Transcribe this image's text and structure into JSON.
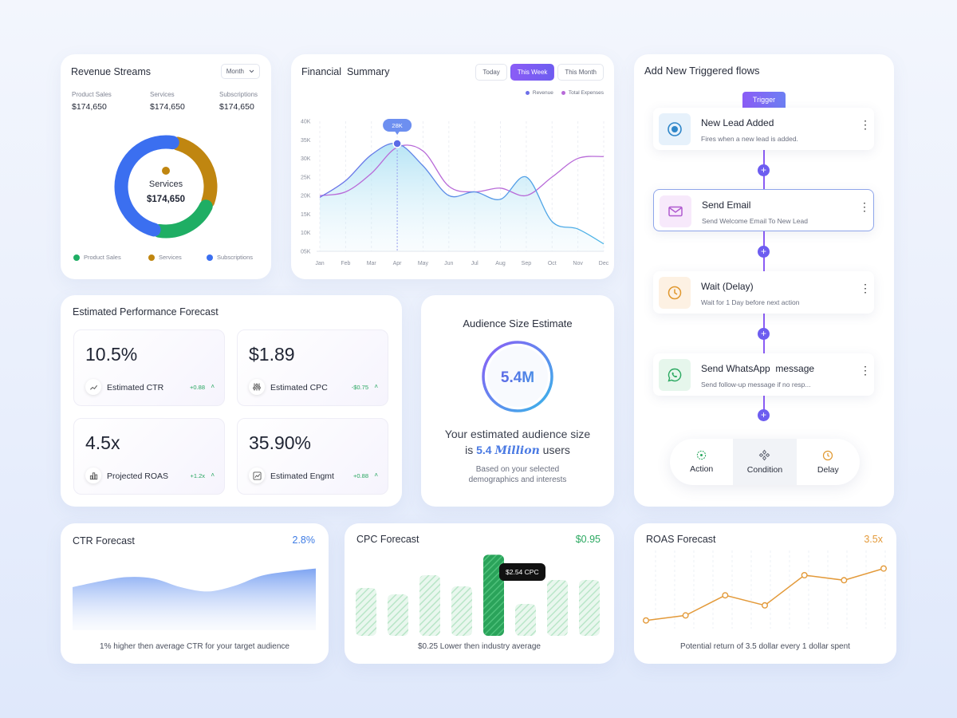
{
  "revenue": {
    "title": "Revenue Streams",
    "dropdown": "Month",
    "stats": [
      {
        "label": "Product Sales",
        "value": "$174,650"
      },
      {
        "label": "Services",
        "value": "$174,650"
      },
      {
        "label": "Subscriptions",
        "value": "$174,650"
      }
    ],
    "center_label": "Services",
    "center_value": "$174,650",
    "legend": [
      {
        "label": "Product Sales",
        "color": "#1fae64"
      },
      {
        "label": "Services",
        "color": "#c08610"
      },
      {
        "label": "Subscriptions",
        "color": "#3b6ff0"
      }
    ]
  },
  "financial": {
    "title": "Financial  Summary",
    "tabs": [
      "Today",
      "This Week",
      "This Month"
    ],
    "active_tab": "This Week",
    "legend": [
      {
        "label": "Revenue",
        "color": "#6d6fe8"
      },
      {
        "label": "Total Expenses",
        "color": "#b86ad8"
      }
    ],
    "tooltip": "28K"
  },
  "flows": {
    "title": "Add New Triggered flows",
    "trigger_label": "Trigger",
    "items": [
      {
        "name": "New Lead Added",
        "desc": "Fires when a new lead is added.",
        "icon": "target-icon",
        "bg": "#e6f1fb",
        "color": "#2f86c9"
      },
      {
        "name": "Send Email",
        "desc": "Send Welcome Email To New Lead",
        "icon": "mail-icon",
        "bg": "#f7e9fb",
        "color": "#b05ad0"
      },
      {
        "name": "Wait (Delay)",
        "desc": "Wait for 1 Day before next action",
        "icon": "clock-icon",
        "bg": "#fdf1e3",
        "color": "#e0972d"
      },
      {
        "name": "Send WhatsApp  message",
        "desc": "Send follow-up message if no resp...",
        "icon": "whatsapp-icon",
        "bg": "#e6f6ec",
        "color": "#2aa860"
      }
    ],
    "tabs": [
      {
        "label": "Action",
        "icon": "action-icon",
        "color": "#2aa860"
      },
      {
        "label": "Condition",
        "icon": "condition-icon",
        "color": "#555a68"
      },
      {
        "label": "Delay",
        "icon": "clock-icon",
        "color": "#e0972d"
      }
    ],
    "active_tab": "Condition"
  },
  "performance": {
    "title": "Estimated Performance Forecast",
    "metrics": [
      {
        "value": "10.5%",
        "label": "Estimated CTR",
        "delta": "+0.88",
        "icon": "trend-icon"
      },
      {
        "value": "$1.89",
        "label": "Estimated CPC",
        "delta": "-$0.75",
        "icon": "sliders-icon"
      },
      {
        "value": "4.5x",
        "label": "Projected ROAS",
        "delta": "+1.2x",
        "icon": "bars-icon"
      },
      {
        "value": "35.90%",
        "label": "Estimated Engmt",
        "delta": "+0.88",
        "icon": "chart-icon"
      }
    ]
  },
  "audience": {
    "title": "Audience Size Estimate",
    "value": "5.4M",
    "line1": "Your estimated audience size",
    "line2_pre": "is",
    "line2_num": "5.4",
    "line2_word": "Million",
    "line2_post": "users",
    "sub1": "Based on your selected",
    "sub2": "demographics and interests"
  },
  "ctr": {
    "title": "CTR Forecast",
    "value": "2.8%",
    "note": "1% higher then average CTR for your target audience",
    "color": "#3d7be4"
  },
  "cpc": {
    "title": "CPC Forecast",
    "value": "$0.95",
    "note": "$0.25 Lower then industry average",
    "tooltip": "$2.54 CPC",
    "color": "#2aa860"
  },
  "roas": {
    "title": "ROAS Forecast",
    "value": "3.5x",
    "note": "Potential return of 3.5 dollar every 1 dollar spent",
    "color": "#e39a3a"
  },
  "chart_data": [
    {
      "type": "pie",
      "title": "Revenue Streams",
      "categories": [
        "Product Sales",
        "Services",
        "Subscriptions"
      ],
      "values": [
        22,
        28,
        50
      ]
    },
    {
      "type": "line",
      "title": "Financial  Summary",
      "categories": [
        "Jan",
        "Feb",
        "Mar",
        "Apr",
        "May",
        "Jun",
        "Jul",
        "Aug",
        "Sep",
        "Oct",
        "Nov",
        "Dec"
      ],
      "y_ticks": [
        "05K",
        "10K",
        "15K",
        "20K",
        "25K",
        "30K",
        "35K",
        "40K"
      ],
      "ylim": [
        5,
        40
      ],
      "series": [
        {
          "name": "Revenue",
          "values": [
            19.5,
            24,
            31,
            34,
            28,
            20,
            21,
            19,
            25,
            13,
            11,
            7
          ]
        },
        {
          "name": "Total Expenses",
          "values": [
            20,
            21,
            26,
            33,
            32,
            22.5,
            21,
            22,
            20,
            25,
            30,
            30.5
          ]
        }
      ]
    },
    {
      "type": "area",
      "title": "CTR Forecast",
      "values": [
        3.0,
        3.4,
        3.7,
        3.6,
        3.0,
        2.7,
        3.1,
        3.8,
        4.1,
        4.3
      ]
    },
    {
      "type": "bar",
      "title": "CPC Forecast",
      "values": [
        1.5,
        1.3,
        1.9,
        1.55,
        2.54,
        1.0,
        1.75,
        1.75
      ]
    },
    {
      "type": "line",
      "title": "ROAS Forecast",
      "values": [
        0.3,
        0.6,
        1.8,
        1.2,
        3.0,
        2.7,
        3.4
      ]
    }
  ]
}
